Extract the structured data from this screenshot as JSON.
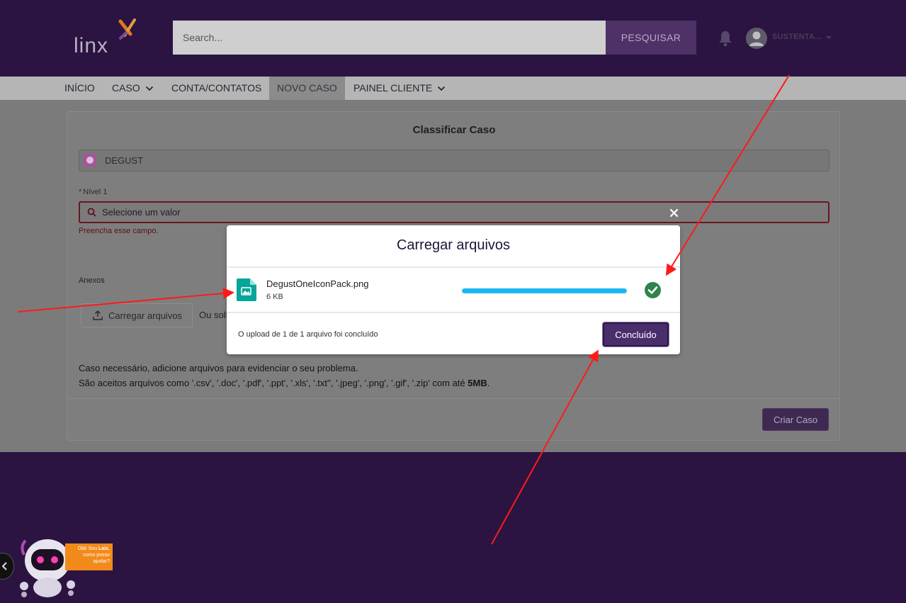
{
  "header": {
    "logo_text": "linx",
    "search_placeholder": "Search...",
    "search_button": "PESQUISAR",
    "user_name": "SUSTENTA..."
  },
  "nav": {
    "items": [
      {
        "label": "INÍCIO",
        "dropdown": false
      },
      {
        "label": "CASO",
        "dropdown": true
      },
      {
        "label": "CONTA/CONTATOS",
        "dropdown": false
      },
      {
        "label": "NOVO CASO",
        "dropdown": false,
        "active": true
      },
      {
        "label": "PAINEL CLIENTE",
        "dropdown": true
      }
    ]
  },
  "form": {
    "title": "Classificar Caso",
    "account_value": "DEGUST",
    "nivel_label": "Nível 1",
    "nivel_required_mark": "*",
    "nivel_placeholder": "Selecione um valor",
    "nivel_error": "Preencha esse campo.",
    "anexos_label": "Anexos",
    "upload_button": "Carregar arquivos",
    "drop_text": "Ou solt",
    "help_line1": "Caso necessário, adicione arquivos para evidenciar o seu problema.",
    "help_line2_prefix": "São aceitos arquivos como ",
    "help_line2_types": "'.csv', '.doc', '.pdf', '.ppt', '.xls', '.txt'', '.jpeg', '.png', '.gif', '.zip'",
    "help_line2_middle": " com até ",
    "help_line2_size": "5MB",
    "help_line2_suffix": ".",
    "submit_button": "Criar Caso"
  },
  "modal": {
    "title": "Carregar arquivos",
    "file_name": "DegustOneIconPack.png",
    "file_size": "6 KB",
    "progress_percent": 100,
    "status_text": "O upload de 1 de 1 arquivo foi concluído",
    "done_button": "Concluído"
  },
  "chatbot": {
    "greeting_prefix": "Olá! Sou ",
    "greeting_name": "Lais",
    "greeting_suffix": ", como posso ajudar?"
  },
  "colors": {
    "header_bg": "#2b1441",
    "accent_purple": "#4a2d6b",
    "progress_blue": "#1ab8f3",
    "success_green": "#2e844a",
    "error_red": "#6b1520",
    "annotation_red": "#ff1a1a"
  },
  "icons": {
    "bell": "bell-icon",
    "user": "user-avatar-icon",
    "search": "search-icon",
    "upload": "upload-icon",
    "file_image": "image-file-icon",
    "success": "check-circle-icon",
    "close": "close-icon"
  }
}
